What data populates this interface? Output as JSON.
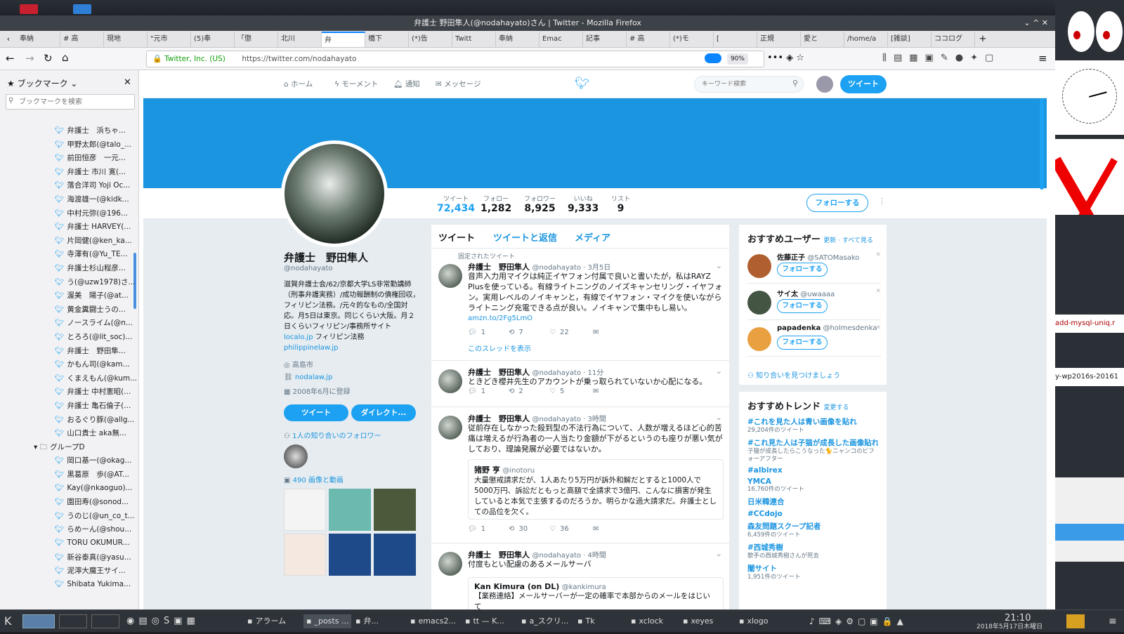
{
  "window_title": "弁護士 野田隼人(@nodahayato)さん | Twitter - Mozilla Firefox",
  "tabs": [
    "奉納",
    "# 高",
    "現地",
    "\"元市",
    "(5)奉",
    "「懲",
    "北川",
    "弁",
    "橋下",
    "(*)告",
    "Twitt",
    "奉納",
    "Emac",
    "記事",
    "# 高",
    "(*)モ",
    "[",
    "正規",
    "愛と",
    "/home/a",
    "[雑談]",
    "ココログ"
  ],
  "url": {
    "site": "Twitter, Inc. (US)",
    "address": "https://twitter.com/nodahayato",
    "zoom": "90%"
  },
  "sidebar": {
    "title": "ブックマーク",
    "search_placeholder": "ブックマークを検索",
    "group": "グループD",
    "items": [
      "弁護士　浜ちゃ...",
      "甲野太郎(@talo_...",
      "前田恒彦　一元...",
      "弁護士 市川 寛(...",
      "落合洋司 Yoji Oc...",
      "海渡雄一(@kidk...",
      "中村元弥(@196...",
      "弁護士 HARVEY(...",
      "片岡健(@ken_ka...",
      "寺澤有(@Yu_TE...",
      "弁護士杉山程彦...",
      "う(@uzw1978)さ...",
      "渥美　陽子(@at...",
      "黄金糞闘士うの...",
      "ノースライム(@n...",
      "とろろ(@lit_soc)...",
      "弁護士　野田隼...",
      "かもん司(@kam...",
      "くまえもん(@kum...",
      "弁護士 中村憲昭(...",
      "弁護士 亀石倫子(...",
      "おるぐり豚(@allg...",
      "山口貴士 aka無..."
    ],
    "items2": [
      "岡口基一(@okag...",
      "黒葛原　歩(@AT...",
      "Kay(@nkaoguo)...",
      "園田寿(@sonod...",
      "うのじ(@un_co_t...",
      "らめーん(@shou...",
      "TORU OKUMUR...",
      "新谷泰真(@yasu...",
      "泥濘大魔王サイ...",
      "Shibata Yukima..."
    ]
  },
  "twnav": {
    "home": "ホーム",
    "moments": "モーメント",
    "notifications": "通知",
    "messages": "メッセージ",
    "search_placeholder": "キーワード検索",
    "tweet_btn": "ツイート"
  },
  "stats": [
    {
      "l": "ツイート",
      "v": "72,434"
    },
    {
      "l": "フォロー",
      "v": "1,282"
    },
    {
      "l": "フォロワー",
      "v": "8,925"
    },
    {
      "l": "いいね",
      "v": "9,333"
    },
    {
      "l": "リスト",
      "v": "9"
    }
  ],
  "follow_btn": "フォローする",
  "profile": {
    "name": "弁護士　野田隼人",
    "handle": "@nodahayato",
    "bio": "滋賀弁護士会/62/京都大学LS非常勤講師（刑事弁護実務）/成功報酬制の債権回収，フィリピン法務。/元々的なもの/全国対応。月5日は東京。同じくらい大阪。月２日くらいフィリピン/事務所サイト",
    "link1": "localo.jp",
    "bio2": "フィリピン法務",
    "link2": "philippinelaw.jp",
    "location": "高島市",
    "website": "nodalaw.jp",
    "joined": "2008年6月に登録",
    "tweet_btn": "ツイート",
    "dm_btn": "ダイレクト...",
    "mutual": "1人の知り合いのフォロワー",
    "media": "490 画像と動画"
  },
  "tabs_tl": [
    "ツイート",
    "ツイートと返信",
    "メディア"
  ],
  "tweets": [
    {
      "pinned": "固定されたツイート",
      "name": "弁護士　野田隼人",
      "meta": "@nodahayato · 3月5日",
      "text": "音声入力用マイクは純正イヤフォン付属で良いと書いたが，私はRAYZ Plusを使っている。有線ライトニングのノイズキャンセリング・イヤフォン。実用レベルのノイキャンと，有線でイヤフォン・マイクを使いながらライトニング充電できる点が良い。ノイキャンで集中もし易い。",
      "link": "amzn.to/2Fg5LmO",
      "r": "1",
      "rt": "7",
      "l": "22",
      "thread": "このスレッドを表示"
    },
    {
      "name": "弁護士　野田隼人",
      "meta": "@nodahayato · 11分",
      "text": "ときどき櫻井先生のアカウントが乗っ取られていないか心配になる。",
      "r": "1",
      "rt": "2",
      "l": "5"
    },
    {
      "name": "弁護士　野田隼人",
      "meta": "@nodahayato · 3時間",
      "text": "従前存在しなかった殺到型の不法行為について、人数が増えるほど心的苦痛は増えるが行為者の一人当たり金額が下がるというのも座りが悪い気がしており、理論発展が必要ではないか。",
      "quote_name": "猪野 亨",
      "quote_handle": "@inotoru",
      "quote": "大量懲戒請求だが、1人あたり5万円が訴外和解だとすると1000人で5000万円、訴訟だともっと高額で全請求で3億円、こんなに損害が発生していると本気で主張するのだろうか。明らかな過大請求だ。弁護士としての品位を欠く。",
      "r": "1",
      "rt": "30",
      "l": "36"
    },
    {
      "name": "弁護士　野田隼人",
      "meta": "@nodahayato · 4時間",
      "text": "付度もとい配慮のあるメールサーバ",
      "quote_name": "Kan Kimura (on DL)",
      "quote_handle": "@kankimura",
      "quote": "【業務連絡】メールサーバーが一定の確率で本部からのメールをはじいて"
    }
  ],
  "who_to_follow": {
    "title": "おすすめユーザー",
    "links": "更新 · すべて見る",
    "users": [
      {
        "name": "佐藤正子",
        "handle": "@SATOMasako"
      },
      {
        "name": "サイ太",
        "handle": "@uwaaaa"
      },
      {
        "name": "papadenka",
        "handle": "@holmesdenka"
      }
    ],
    "follow": "フォローする",
    "find": "知り合いを見つけましょう"
  },
  "trends": {
    "title": "おすすめトレンド",
    "change": "変更する",
    "items": [
      {
        "t": "#これを見た人は青い画像を貼れ",
        "s": "29,204件のツイート"
      },
      {
        "t": "#これ見た人は子猫が成長した画像貼れ",
        "s": "子猫が成長したらこうなった🐈ニャンコのビフォーアフター"
      },
      {
        "t": "#albirex",
        "s": ""
      },
      {
        "t": "YMCA",
        "s": "16,760件のツイート"
      },
      {
        "t": "日米韓連合",
        "s": ""
      },
      {
        "t": "#CCdojo",
        "s": ""
      },
      {
        "t": "森友問題スクープ記者",
        "s": "6,459件のツイート"
      },
      {
        "t": "#西城秀樹",
        "s": "歌手の西城秀樹さんが死去"
      },
      {
        "t": "闇サイト",
        "s": "1,951件のツイート"
      }
    ]
  },
  "taskbar": {
    "items": [
      "アラーム",
      "_posts ...",
      "弁...",
      "emacs2...",
      "tt — K...",
      "a_スクリ...",
      "Tk",
      "xclock",
      "xeyes",
      "xlogo"
    ],
    "time": "21:10",
    "date": "2018年5月17日木曜日"
  },
  "right": {
    "t1": "add-mysql-uniq.r",
    "t2": "y-wp2016s-20161"
  }
}
